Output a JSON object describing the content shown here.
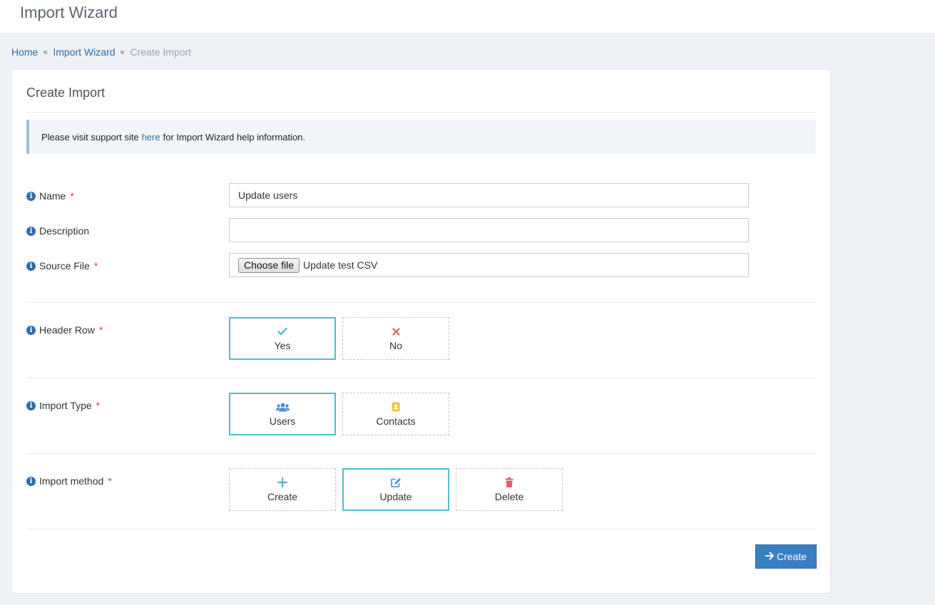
{
  "header": {
    "title": "Import Wizard"
  },
  "breadcrumb": {
    "home": "Home",
    "parent": "Import Wizard",
    "current": "Create Import"
  },
  "card": {
    "title": "Create Import"
  },
  "alert": {
    "prefix": "Please visit support site",
    "link": "here",
    "suffix": "for Import Wizard help information."
  },
  "form": {
    "info_glyph": "i",
    "required_mark": "*",
    "name": {
      "label": "Name",
      "value": "Update users"
    },
    "description": {
      "label": "Description",
      "value": ""
    },
    "source_file": {
      "label": "Source File",
      "button": "Choose file",
      "file_name": "Update test CSV"
    },
    "header_row": {
      "label": "Header Row",
      "options": [
        {
          "label": "Yes",
          "icon": "check-icon",
          "selected": true
        },
        {
          "label": "No",
          "icon": "times-icon",
          "selected": false
        }
      ]
    },
    "import_type": {
      "label": "Import Type",
      "options": [
        {
          "label": "Users",
          "icon": "users-icon",
          "selected": true
        },
        {
          "label": "Contacts",
          "icon": "contact-card-icon",
          "selected": false
        }
      ]
    },
    "import_method": {
      "label": "Import method",
      "options": [
        {
          "label": "Create",
          "icon": "plus-icon",
          "selected": false
        },
        {
          "label": "Update",
          "icon": "edit-icon",
          "selected": true
        },
        {
          "label": "Delete",
          "icon": "trash-icon",
          "selected": false
        }
      ]
    }
  },
  "actions": {
    "create_label": "Create"
  },
  "colors": {
    "accent": "#53bdc9",
    "primary": "#3a7fc2",
    "link": "#2d6ea8",
    "required": "#e0384d",
    "danger": "#e35d6a",
    "warning": "#f0c33c"
  }
}
